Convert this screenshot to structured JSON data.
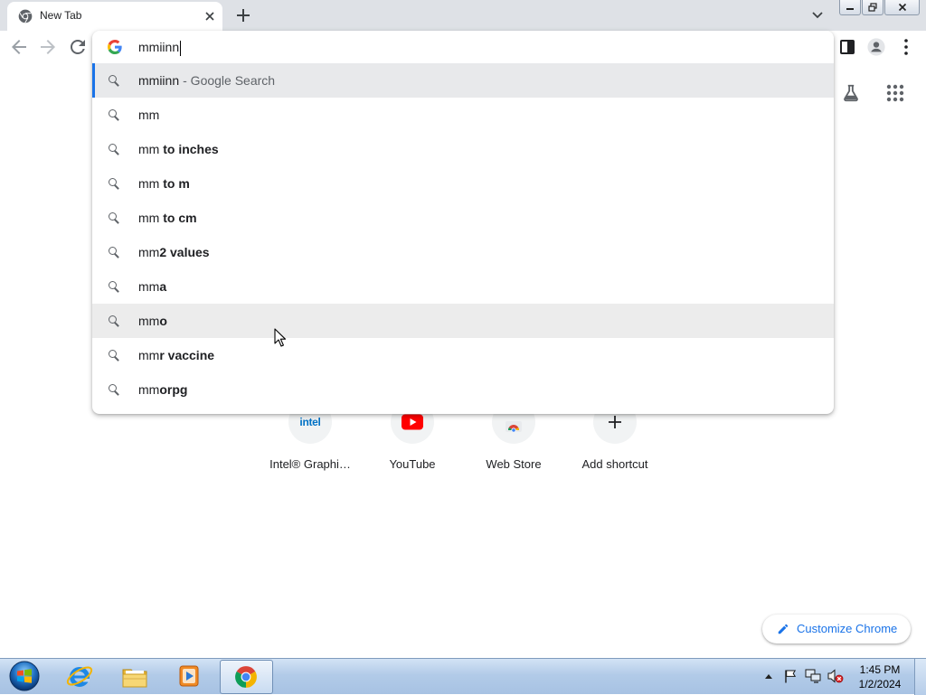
{
  "browser": {
    "tab_title": "New Tab",
    "omnibox_value": "mmiinn"
  },
  "suggestions": [
    {
      "normal": "mmiinn",
      "hint": "- Google Search"
    },
    {
      "normal": "mm"
    },
    {
      "normal": "mm ",
      "bold": "to inches"
    },
    {
      "normal": "mm ",
      "bold": "to m"
    },
    {
      "normal": "mm ",
      "bold": "to cm"
    },
    {
      "normal": "mm",
      "bold": "2 values"
    },
    {
      "normal": "mm",
      "bold": "a"
    },
    {
      "normal": "mm",
      "bold": "o"
    },
    {
      "normal": "mm",
      "bold": "r vaccine"
    },
    {
      "normal": "mm",
      "bold": "orpg"
    }
  ],
  "shortcuts": [
    {
      "label": "Intel® Graphi…",
      "icon": "intel-icon",
      "icon_text": "intel"
    },
    {
      "label": "YouTube",
      "icon": "youtube-icon"
    },
    {
      "label": "Web Store",
      "icon": "web-store-icon"
    },
    {
      "label": "Add shortcut",
      "icon": "plus-icon"
    }
  ],
  "customize": {
    "label": "Customize Chrome",
    "icon": "pencil-icon"
  },
  "taskbar": {
    "clock_time": "1:45 PM",
    "clock_date": "1/2/2024",
    "pinned_icons": [
      "start-orb-icon",
      "internet-explorer-icon",
      "file-explorer-icon",
      "media-player-icon",
      "chrome-icon"
    ],
    "tray_icons": [
      "show-hidden-icons-icon",
      "action-center-flag-icon",
      "network-icon",
      "volume-muted-icon"
    ]
  },
  "colors": {
    "accent": "#1a73e8",
    "tab_strip": "#dee1e6",
    "selection_bar": "#1a73e8",
    "youtube_red": "#ff0000",
    "intel_blue": "#0071c5"
  }
}
